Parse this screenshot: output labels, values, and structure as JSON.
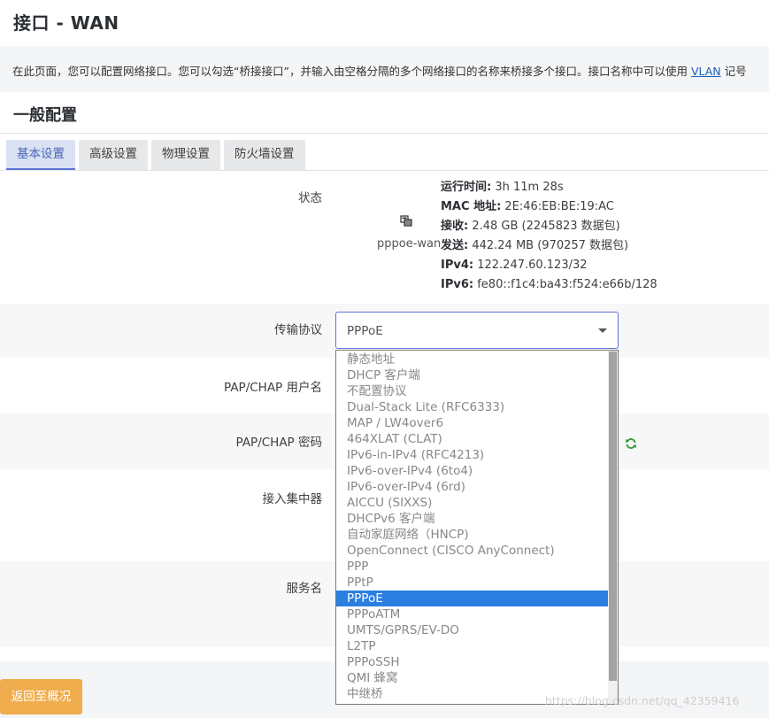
{
  "page": {
    "title": "接口 - WAN",
    "description_prefix": "在此页面，您可以配置网络接口。您可以勾选“桥接接口”，并输入由空格分隔的多个网络接口的名称来桥接多个接口。接口名称中可以使用 ",
    "description_link": "VLAN",
    "description_suffix": " 记号"
  },
  "section": {
    "title": "一般配置"
  },
  "tabs": [
    {
      "label": "基本设置",
      "active": true
    },
    {
      "label": "高级设置",
      "active": false
    },
    {
      "label": "物理设置",
      "active": false
    },
    {
      "label": "防火墙设置",
      "active": false
    }
  ],
  "status": {
    "label": "状态",
    "interface": "pppoe-wan",
    "lines": [
      {
        "key": "运行时间:",
        "value": " 3h 11m 28s"
      },
      {
        "key": "MAC 地址:",
        "value": " 2E:46:EB:BE:19:AC"
      },
      {
        "key": "接收:",
        "value": " 2.48 GB (2245823 数据包)"
      },
      {
        "key": "发送:",
        "value": " 442.24 MB (970257 数据包)"
      },
      {
        "key": "IPv4:",
        "value": " 122.247.60.123/32"
      },
      {
        "key": "IPv6:",
        "value": " fe80::f1c4:ba43:f524:e66b/128"
      }
    ]
  },
  "fields": {
    "protocol_label": "传输协议",
    "protocol_value": "PPPoE",
    "username_label": "PAP/CHAP 用户名",
    "password_label": "PAP/CHAP 密码",
    "concentrator_label": "接入集中器",
    "service_label": "服务名"
  },
  "dropdown": {
    "options": [
      "静态地址",
      "DHCP 客户端",
      "不配置协议",
      "Dual-Stack Lite (RFC6333)",
      "MAP / LW4over6",
      "464XLAT (CLAT)",
      "IPv6-in-IPv4 (RFC4213)",
      "IPv6-over-IPv4 (6to4)",
      "IPv6-over-IPv4 (6rd)",
      "AICCU (SIXXS)",
      "DHCPv6 客户端",
      "自动家庭网络（HNCP)",
      "OpenConnect (CISCO AnyConnect)",
      "PPP",
      "PPtP",
      "PPPoE",
      "PPPoATM",
      "UMTS/GPRS/EV-DO",
      "L2TP",
      "PPPoSSH",
      "QMI 蜂窝",
      "中继桥"
    ],
    "selected": "PPPoE"
  },
  "footer": {
    "back_label": "返回至概况"
  },
  "watermark": "https://blog.csdn.net/qq_42359416",
  "colors": {
    "accent": "#5e72d4",
    "selected": "#2b7fe0",
    "back_button": "#f0ad4e"
  },
  "icons": {
    "status": "network-interface-icon",
    "password_reveal": "refresh-icon"
  }
}
